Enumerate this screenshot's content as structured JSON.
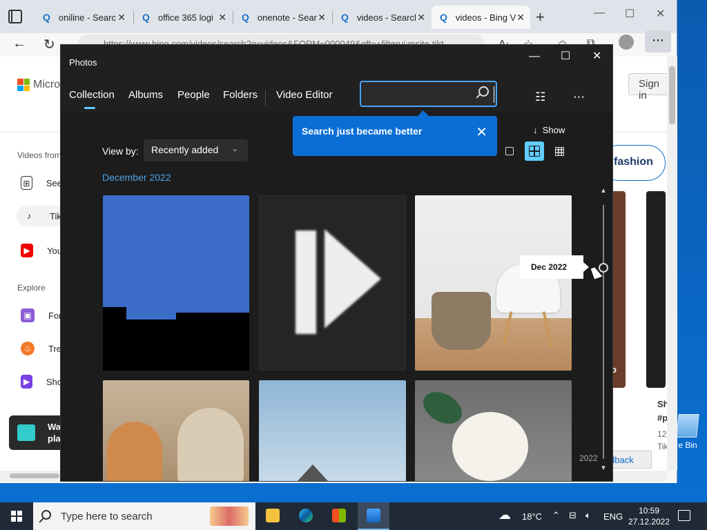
{
  "desktop": {
    "recycle_bin_label": "e Bin"
  },
  "browser": {
    "tabs": [
      {
        "title": "oniline - Searc"
      },
      {
        "title": "office 365 logi"
      },
      {
        "title": "onenote - Sear"
      },
      {
        "title": "videos - Searcl"
      },
      {
        "title": "videos - Bing V"
      }
    ],
    "url": "https://www.bing.com/videos/search?q=videos&FORM=000049&qft=+filterui:msite-tikt...",
    "page": {
      "brand": "Micros",
      "sign_in": "Sign in",
      "sidebar_title": "Videos from",
      "sidebar_items": [
        "See",
        "Tik",
        "You"
      ],
      "explore_title": "Explore",
      "explore_items": [
        "For",
        "Tre",
        "Sho"
      ],
      "promo_text_line1": "Wa",
      "promo_text_line2": "pla",
      "fashion_pill": "fashion",
      "card_snippet_1": "Sh",
      "card_snippet_2": "#p",
      "card_snippet_3": "12",
      "card_snippet_4": "Tik",
      "card_snippet_5": "o",
      "feedback": "dback"
    }
  },
  "photos": {
    "title": "Photos",
    "nav": [
      "Collection",
      "Albums",
      "People",
      "Folders",
      "Video Editor"
    ],
    "search": {
      "value": "",
      "placeholder": ""
    },
    "tip": {
      "text": "Search just became better"
    },
    "show_label": "Show",
    "view_by_label": "View by:",
    "view_by_value": "Recently added",
    "section_heading": "December 2022",
    "timeline": {
      "tooltip": "Dec 2022",
      "year": "2022"
    }
  },
  "taskbar": {
    "search_placeholder": "Type here to search",
    "weather": "18°C",
    "language": "ENG",
    "time": "10:59",
    "date": "27.12.2022"
  }
}
